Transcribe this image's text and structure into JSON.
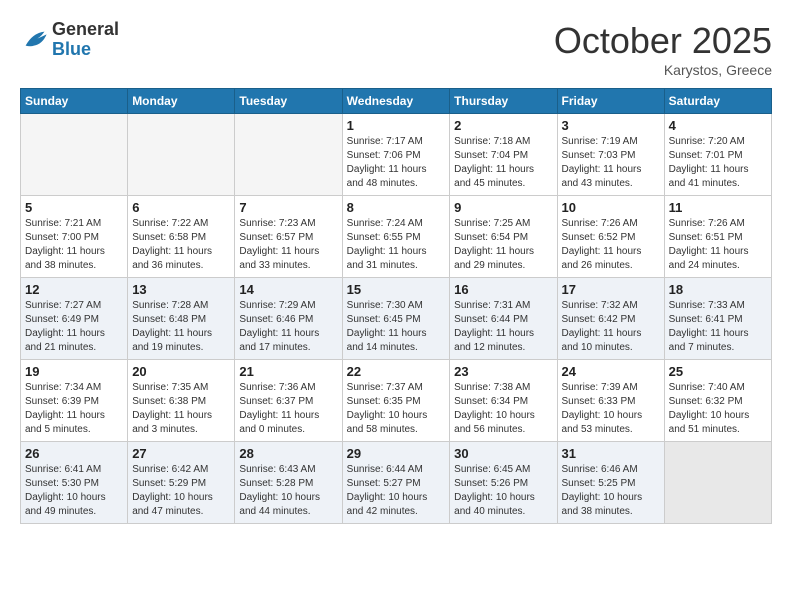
{
  "header": {
    "logo_general": "General",
    "logo_blue": "Blue",
    "month_title": "October 2025",
    "location": "Karystos, Greece"
  },
  "weekdays": [
    "Sunday",
    "Monday",
    "Tuesday",
    "Wednesday",
    "Thursday",
    "Friday",
    "Saturday"
  ],
  "weeks": [
    [
      {
        "day": "",
        "info": ""
      },
      {
        "day": "",
        "info": ""
      },
      {
        "day": "",
        "info": ""
      },
      {
        "day": "1",
        "info": "Sunrise: 7:17 AM\nSunset: 7:06 PM\nDaylight: 11 hours\nand 48 minutes."
      },
      {
        "day": "2",
        "info": "Sunrise: 7:18 AM\nSunset: 7:04 PM\nDaylight: 11 hours\nand 45 minutes."
      },
      {
        "day": "3",
        "info": "Sunrise: 7:19 AM\nSunset: 7:03 PM\nDaylight: 11 hours\nand 43 minutes."
      },
      {
        "day": "4",
        "info": "Sunrise: 7:20 AM\nSunset: 7:01 PM\nDaylight: 11 hours\nand 41 minutes."
      }
    ],
    [
      {
        "day": "5",
        "info": "Sunrise: 7:21 AM\nSunset: 7:00 PM\nDaylight: 11 hours\nand 38 minutes."
      },
      {
        "day": "6",
        "info": "Sunrise: 7:22 AM\nSunset: 6:58 PM\nDaylight: 11 hours\nand 36 minutes."
      },
      {
        "day": "7",
        "info": "Sunrise: 7:23 AM\nSunset: 6:57 PM\nDaylight: 11 hours\nand 33 minutes."
      },
      {
        "day": "8",
        "info": "Sunrise: 7:24 AM\nSunset: 6:55 PM\nDaylight: 11 hours\nand 31 minutes."
      },
      {
        "day": "9",
        "info": "Sunrise: 7:25 AM\nSunset: 6:54 PM\nDaylight: 11 hours\nand 29 minutes."
      },
      {
        "day": "10",
        "info": "Sunrise: 7:26 AM\nSunset: 6:52 PM\nDaylight: 11 hours\nand 26 minutes."
      },
      {
        "day": "11",
        "info": "Sunrise: 7:26 AM\nSunset: 6:51 PM\nDaylight: 11 hours\nand 24 minutes."
      }
    ],
    [
      {
        "day": "12",
        "info": "Sunrise: 7:27 AM\nSunset: 6:49 PM\nDaylight: 11 hours\nand 21 minutes."
      },
      {
        "day": "13",
        "info": "Sunrise: 7:28 AM\nSunset: 6:48 PM\nDaylight: 11 hours\nand 19 minutes."
      },
      {
        "day": "14",
        "info": "Sunrise: 7:29 AM\nSunset: 6:46 PM\nDaylight: 11 hours\nand 17 minutes."
      },
      {
        "day": "15",
        "info": "Sunrise: 7:30 AM\nSunset: 6:45 PM\nDaylight: 11 hours\nand 14 minutes."
      },
      {
        "day": "16",
        "info": "Sunrise: 7:31 AM\nSunset: 6:44 PM\nDaylight: 11 hours\nand 12 minutes."
      },
      {
        "day": "17",
        "info": "Sunrise: 7:32 AM\nSunset: 6:42 PM\nDaylight: 11 hours\nand 10 minutes."
      },
      {
        "day": "18",
        "info": "Sunrise: 7:33 AM\nSunset: 6:41 PM\nDaylight: 11 hours\nand 7 minutes."
      }
    ],
    [
      {
        "day": "19",
        "info": "Sunrise: 7:34 AM\nSunset: 6:39 PM\nDaylight: 11 hours\nand 5 minutes."
      },
      {
        "day": "20",
        "info": "Sunrise: 7:35 AM\nSunset: 6:38 PM\nDaylight: 11 hours\nand 3 minutes."
      },
      {
        "day": "21",
        "info": "Sunrise: 7:36 AM\nSunset: 6:37 PM\nDaylight: 11 hours\nand 0 minutes."
      },
      {
        "day": "22",
        "info": "Sunrise: 7:37 AM\nSunset: 6:35 PM\nDaylight: 10 hours\nand 58 minutes."
      },
      {
        "day": "23",
        "info": "Sunrise: 7:38 AM\nSunset: 6:34 PM\nDaylight: 10 hours\nand 56 minutes."
      },
      {
        "day": "24",
        "info": "Sunrise: 7:39 AM\nSunset: 6:33 PM\nDaylight: 10 hours\nand 53 minutes."
      },
      {
        "day": "25",
        "info": "Sunrise: 7:40 AM\nSunset: 6:32 PM\nDaylight: 10 hours\nand 51 minutes."
      }
    ],
    [
      {
        "day": "26",
        "info": "Sunrise: 6:41 AM\nSunset: 5:30 PM\nDaylight: 10 hours\nand 49 minutes."
      },
      {
        "day": "27",
        "info": "Sunrise: 6:42 AM\nSunset: 5:29 PM\nDaylight: 10 hours\nand 47 minutes."
      },
      {
        "day": "28",
        "info": "Sunrise: 6:43 AM\nSunset: 5:28 PM\nDaylight: 10 hours\nand 44 minutes."
      },
      {
        "day": "29",
        "info": "Sunrise: 6:44 AM\nSunset: 5:27 PM\nDaylight: 10 hours\nand 42 minutes."
      },
      {
        "day": "30",
        "info": "Sunrise: 6:45 AM\nSunset: 5:26 PM\nDaylight: 10 hours\nand 40 minutes."
      },
      {
        "day": "31",
        "info": "Sunrise: 6:46 AM\nSunset: 5:25 PM\nDaylight: 10 hours\nand 38 minutes."
      },
      {
        "day": "",
        "info": ""
      }
    ]
  ]
}
